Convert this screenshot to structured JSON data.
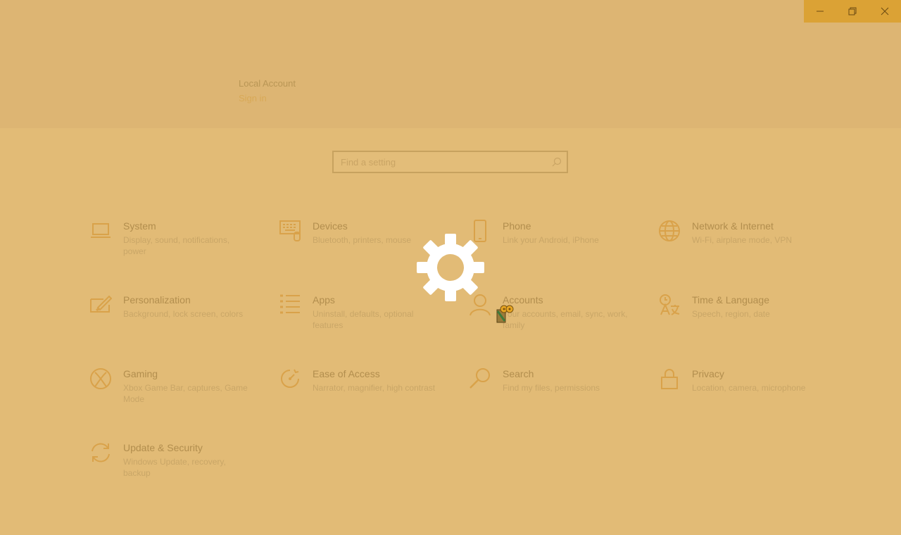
{
  "window": {
    "controls": {
      "minimize_glyph": "—",
      "restore_glyph": "❐",
      "close_glyph": "✕"
    }
  },
  "account": {
    "name": "Local Account",
    "sign_in": "Sign in"
  },
  "search": {
    "placeholder": "Find a setting",
    "value": ""
  },
  "tiles": [
    {
      "id": "system",
      "title": "System",
      "desc": "Display, sound, notifications, power",
      "icon": "laptop-icon"
    },
    {
      "id": "devices",
      "title": "Devices",
      "desc": "Bluetooth, printers, mouse",
      "icon": "keyboard-icon"
    },
    {
      "id": "phone",
      "title": "Phone",
      "desc": "Link your Android, iPhone",
      "icon": "phone-icon"
    },
    {
      "id": "network",
      "title": "Network & Internet",
      "desc": "Wi-Fi, airplane mode, VPN",
      "icon": "globe-icon"
    },
    {
      "id": "personalization",
      "title": "Personalization",
      "desc": "Background, lock screen, colors",
      "icon": "paintbrush-icon"
    },
    {
      "id": "apps",
      "title": "Apps",
      "desc": "Uninstall, defaults, optional features",
      "icon": "apps-list-icon"
    },
    {
      "id": "accounts",
      "title": "Accounts",
      "desc": "Your accounts, email, sync, work, family",
      "icon": "person-icon"
    },
    {
      "id": "time-language",
      "title": "Time & Language",
      "desc": "Speech, region, date",
      "icon": "language-icon"
    },
    {
      "id": "gaming",
      "title": "Gaming",
      "desc": "Xbox Game Bar, captures, Game Mode",
      "icon": "xbox-icon"
    },
    {
      "id": "ease-of-access",
      "title": "Ease of Access",
      "desc": "Narrator, magnifier, high contrast",
      "icon": "ease-of-access-icon"
    },
    {
      "id": "search",
      "title": "Search",
      "desc": "Find my files, permissions",
      "icon": "magnifier-icon"
    },
    {
      "id": "privacy",
      "title": "Privacy",
      "desc": "Location, camera, microphone",
      "icon": "lock-icon"
    },
    {
      "id": "update-security",
      "title": "Update & Security",
      "desc": "Windows Update, recovery, backup",
      "icon": "sync-icon"
    }
  ],
  "colors": {
    "background": "#e2bb76",
    "header": "#ddb573",
    "accent": "#dba235",
    "icon": "#d9a24a",
    "text": "#b28e4e"
  }
}
